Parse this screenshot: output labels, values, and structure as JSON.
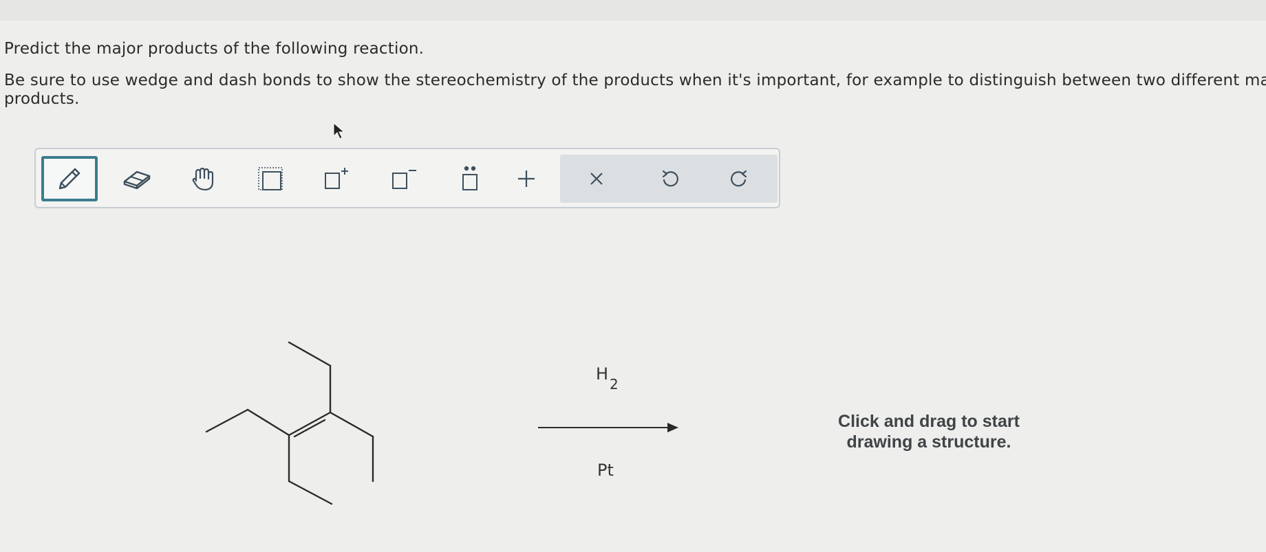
{
  "question": {
    "line1": "Predict the major products of the following reaction.",
    "line2": "Be sure to use wedge and dash bonds to show the stereochemistry of the products when it's important, for example to distinguish between two different major",
    "line3": "products."
  },
  "toolbar": {
    "tools": [
      {
        "name": "pencil-tool",
        "icon": "pencil-icon",
        "active": true
      },
      {
        "name": "eraser-tool",
        "icon": "eraser-icon",
        "active": false
      },
      {
        "name": "hand-tool",
        "icon": "hand-icon",
        "active": false
      },
      {
        "name": "select-tool",
        "icon": "selection-box-icon",
        "active": false
      },
      {
        "name": "positive-charge-tool",
        "icon": "box-plus-icon",
        "active": false
      },
      {
        "name": "negative-charge-tool",
        "icon": "box-minus-icon",
        "active": false
      },
      {
        "name": "lone-pair-tool",
        "icon": "box-lone-pair-icon",
        "active": false
      },
      {
        "name": "add-tool",
        "icon": "plus-icon",
        "active": false
      }
    ],
    "actions": [
      {
        "name": "clear-button",
        "icon": "x-icon"
      },
      {
        "name": "undo-button",
        "icon": "undo-icon"
      },
      {
        "name": "redo-button",
        "icon": "redo-icon"
      }
    ],
    "plus_glyph": "+",
    "x_glyph": "×",
    "plus_sup": "+",
    "minus_sup": "−",
    "lone_pair_dots": "••"
  },
  "reaction": {
    "reagent_top": "H",
    "reagent_top_subscript": "2",
    "reagent_bottom": "Pt"
  },
  "canvas": {
    "hint_line1": "Click and drag to start",
    "hint_line2": "drawing a structure."
  },
  "colors": {
    "accent": "#3a7d8e",
    "toolbar_border": "#c9cdd1",
    "action_bg": "#dcdfe2"
  }
}
